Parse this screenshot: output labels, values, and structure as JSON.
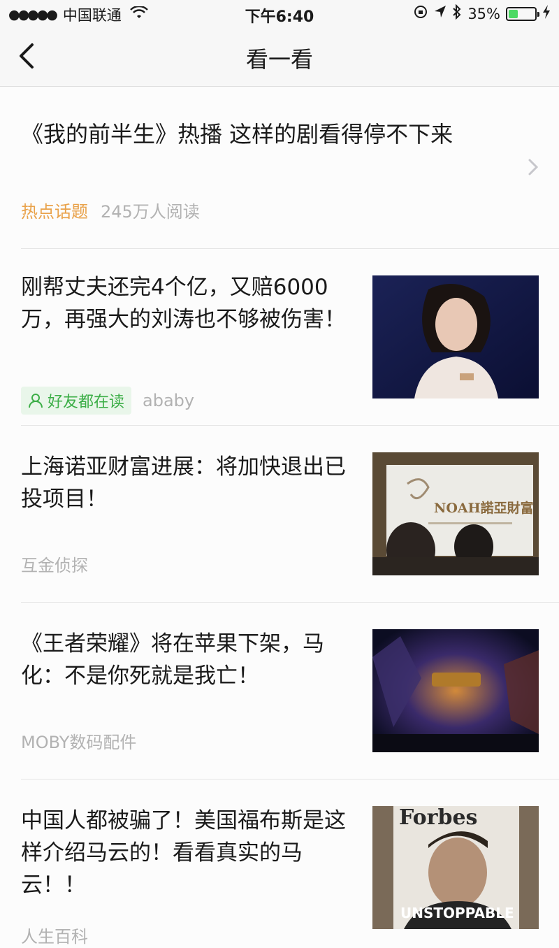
{
  "status_bar": {
    "signal": "●●●●●",
    "carrier": "中国联通",
    "time": "下午6:40",
    "battery_percent_text": "35%",
    "battery_level": 0.35
  },
  "nav": {
    "title": "看一看"
  },
  "hot_topic": {
    "title": "《我的前半生》热播 这样的剧看得停不下来",
    "tag": "热点话题",
    "reads": "245万人阅读"
  },
  "articles": [
    {
      "title": "刚帮丈夫还完4个亿，又赔6000万，再强大的刘涛也不够被伤害！",
      "badge": "好友都在读",
      "source": "ababy"
    },
    {
      "title": "上海诺亚财富进展：将加快退出已投项目！",
      "source": "互金侦探",
      "thumb_text": "NOAH諾亞財富"
    },
    {
      "title": "《王者荣耀》将在苹果下架，马化：不是你死就是我亡！",
      "source": "MOBY数码配件"
    },
    {
      "title": "中国人都被骗了！美国福布斯是这样介绍马云的！看看真实的马云！！",
      "source": "人生百科",
      "thumb_masthead": "Forbes",
      "thumb_headline": "UNSTOPPABLE"
    }
  ],
  "colors": {
    "accent_orange": "#e9a24a",
    "accent_green": "#3cae47",
    "muted_text": "#b2b2b2",
    "battery_green": "#4cd964"
  }
}
